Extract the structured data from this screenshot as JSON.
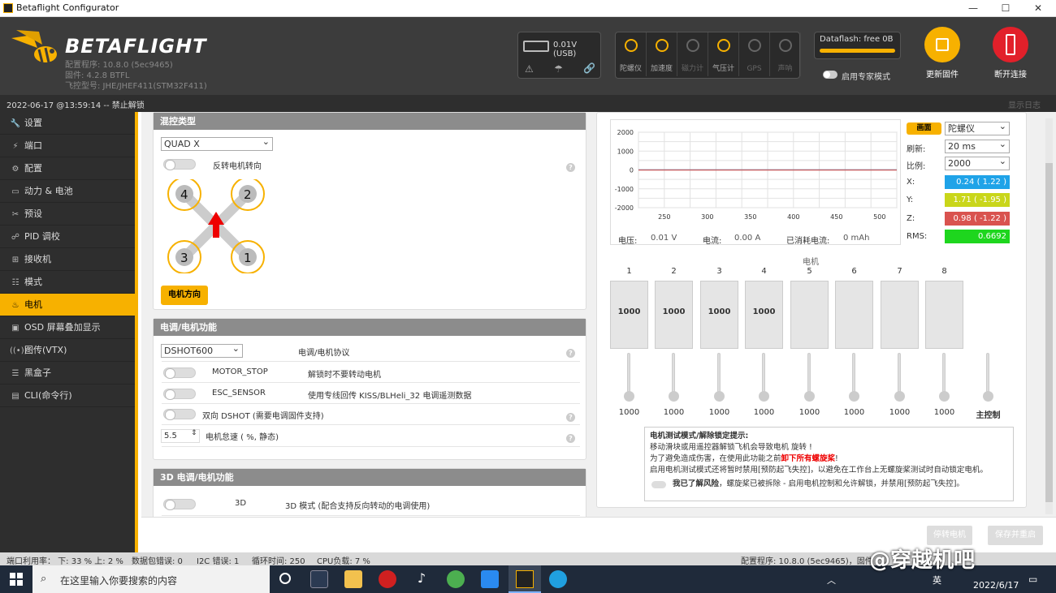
{
  "window": {
    "title": "Betaflight Configurator",
    "min": "—",
    "max": "☐",
    "close": "✕"
  },
  "header": {
    "brand": "BETAFLIGHT",
    "config_version": "配置程序: 10.8.0 (5ec9465)",
    "firmware": "固件: 4.2.8 BTFL",
    "fc_type": "飞控型号: JHE/JHEF411(STM32F411)",
    "battery": "0.01V (USB)",
    "sensors": [
      {
        "label": "陀螺仪",
        "icon": "gyro-icon",
        "active": true
      },
      {
        "label": "加速度",
        "icon": "accel-icon",
        "active": true
      },
      {
        "label": "磁力计",
        "icon": "mag-icon",
        "active": false
      },
      {
        "label": "气压计",
        "icon": "baro-icon",
        "active": true
      },
      {
        "label": "GPS",
        "icon": "gps-icon",
        "active": false
      },
      {
        "label": "声呐",
        "icon": "sonar-icon",
        "active": false
      }
    ],
    "dataflash": "Dataflash: free 0B",
    "expert_mode": "启用专家模式",
    "update_firmware": "更新固件",
    "disconnect": "断开连接"
  },
  "statusbar": {
    "left": "2022-06-17 @13:59:14 -- 禁止解锁",
    "right": "显示日志"
  },
  "sidebar": {
    "items": [
      {
        "label": "设置",
        "icon": "wrench-icon",
        "glyph": "🔧"
      },
      {
        "label": "端口",
        "icon": "plug-icon",
        "glyph": "⚡"
      },
      {
        "label": "配置",
        "icon": "gear-icon",
        "glyph": "⚙"
      },
      {
        "label": "动力 & 电池",
        "icon": "battery-icon",
        "glyph": "▭"
      },
      {
        "label": "预设",
        "icon": "tools-icon",
        "glyph": "✂"
      },
      {
        "label": "PID 调校",
        "icon": "pid-icon",
        "glyph": "☍"
      },
      {
        "label": "接收机",
        "icon": "receiver-icon",
        "glyph": "⊞"
      },
      {
        "label": "模式",
        "icon": "modes-icon",
        "glyph": "☷"
      },
      {
        "label": "电机",
        "icon": "motor-icon",
        "glyph": "♨",
        "active": true
      },
      {
        "label": "OSD 屏幕叠加显示",
        "icon": "osd-icon",
        "glyph": "▣"
      },
      {
        "label": "图传(VTX)",
        "icon": "vtx-icon",
        "glyph": "((•))"
      },
      {
        "label": "黑盒子",
        "icon": "blackbox-icon",
        "glyph": "☰"
      },
      {
        "label": "CLI(命令行)",
        "icon": "cli-icon",
        "glyph": "▤"
      }
    ]
  },
  "mixer": {
    "title": "混控类型",
    "value": "QUAD X",
    "reverse": "反转电机转向",
    "direction_btn": "电机方向",
    "motors": [
      "4",
      "2",
      "3",
      "1"
    ]
  },
  "esc": {
    "title": "电调/电机功能",
    "protocol_value": "DSHOT600",
    "protocol_label": "电调/电机协议",
    "motor_stop": "MOTOR_STOP",
    "motor_stop_desc": "解锁时不要转动电机",
    "esc_sensor": "ESC_SENSOR",
    "esc_sensor_desc": "使用专线回传 KISS/BLHeli_32 电调遥测数据",
    "bidir": "双向 DSHOT (需要电调固件支持)",
    "idle_value": "5.5",
    "idle_label": "电机怠速 ( %, 静态)"
  },
  "esc3d": {
    "title": "3D 电调/电机功能",
    "label": "3D",
    "desc": "3D 模式 (配合支持反向转动的电调使用)"
  },
  "graph": {
    "yticks": [
      "2000",
      "1000",
      "0",
      "-1000",
      "-2000"
    ],
    "xticks": [
      "250",
      "300",
      "350",
      "400",
      "450",
      "500"
    ],
    "voltage_label": "电压:",
    "voltage": "0.01 V",
    "current_label": "电流:",
    "current": "0.00 A",
    "mah_label": "已消耗电流:",
    "mah": "0 mAh",
    "sensor_btn": "画面",
    "sensor_select": "陀螺仪",
    "refresh_label": "刷新:",
    "refresh": "20 ms",
    "scale_label": "比例:",
    "scale": "2000",
    "x_label": "X:",
    "x": "0.24 ( 1.22 )",
    "y_label": "Y:",
    "y": "1.71 ( -1.95 )",
    "z_label": "Z:",
    "z": "0.98 ( -1.22 )",
    "rms_label": "RMS:",
    "rms": "0.6692"
  },
  "motors": {
    "title": "电机",
    "numbers": [
      "1",
      "2",
      "3",
      "4",
      "5",
      "6",
      "7",
      "8"
    ],
    "values": [
      "1000",
      "1000",
      "1000",
      "1000",
      "",
      "",
      "",
      ""
    ],
    "slider_values": [
      "1000",
      "1000",
      "1000",
      "1000",
      "1000",
      "1000",
      "1000",
      "1000"
    ],
    "master": "主控制"
  },
  "warning": {
    "title": "电机测试模式/解除锁定提示:",
    "line1": "移动滑块或用遥控器解锁飞机会导致电机 旋转 !",
    "line2a": "为了避免造成伤害，在使用此功能之前",
    "line2b": "卸下所有螺旋桨",
    "line2c": "!",
    "line3": "启用电机测试模式还将暂时禁用[预防起飞失控]，以避免在工作台上无螺旋桨测试时自动锁定电机。",
    "ack": "我已了解风险",
    "ack_desc": "，螺旋桨已被拆除 - 启用电机控制和允许解锁，并禁用[预防起飞失控]。"
  },
  "actions": {
    "stop": "停转电机",
    "save": "保存并重启"
  },
  "footer": {
    "port": "端口利用率： 下: 33 %  上: 2 %",
    "packet_err": "数据包错误: 0",
    "i2c_err": "I2C 错误: 1",
    "cycle": "循环时间: 250",
    "cpu": "CPU负载: 7 %",
    "right": "配置程序: 10.8.0 (5ec9465)，固件"
  },
  "taskbar": {
    "search": "在这里输入你要搜索的内容",
    "date": "2022/6/17",
    "lang": "英",
    "watermark": "@穿越机吧"
  },
  "colors": {
    "accent": "#f7b100",
    "x": "#1fa3e8",
    "y": "#c9d61a",
    "z": "#d9534f",
    "rms": "#1ed61e"
  }
}
